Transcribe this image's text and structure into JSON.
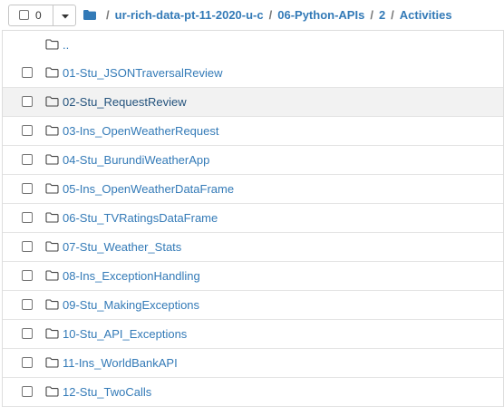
{
  "header": {
    "selected_count": "0",
    "breadcrumb": [
      {
        "label": "ur-rich-data-pt-11-2020-u-c"
      },
      {
        "label": "06-Python-APIs"
      },
      {
        "label": "2"
      },
      {
        "label": "Activities"
      }
    ],
    "separator": "/"
  },
  "listing": {
    "parent_label": "..",
    "items": [
      {
        "name": "01-Stu_JSONTraversalReview"
      },
      {
        "name": "02-Stu_RequestReview"
      },
      {
        "name": "03-Ins_OpenWeatherRequest"
      },
      {
        "name": "04-Stu_BurundiWeatherApp"
      },
      {
        "name": "05-Ins_OpenWeatherDataFrame"
      },
      {
        "name": "06-Stu_TVRatingsDataFrame"
      },
      {
        "name": "07-Stu_Weather_Stats"
      },
      {
        "name": "08-Ins_ExceptionHandling"
      },
      {
        "name": "09-Stu_MakingExceptions"
      },
      {
        "name": "10-Stu_API_Exceptions"
      },
      {
        "name": "11-Ins_WorldBankAPI"
      },
      {
        "name": "12-Stu_TwoCalls"
      }
    ]
  },
  "colors": {
    "link": "#337ab7",
    "hover_row": "#f2f2f2",
    "border": "#dddddd"
  },
  "icons": {
    "breadcrumb_root": "folder-icon",
    "row_icon": "folder-icon",
    "dropdown": "caret-down-icon"
  }
}
